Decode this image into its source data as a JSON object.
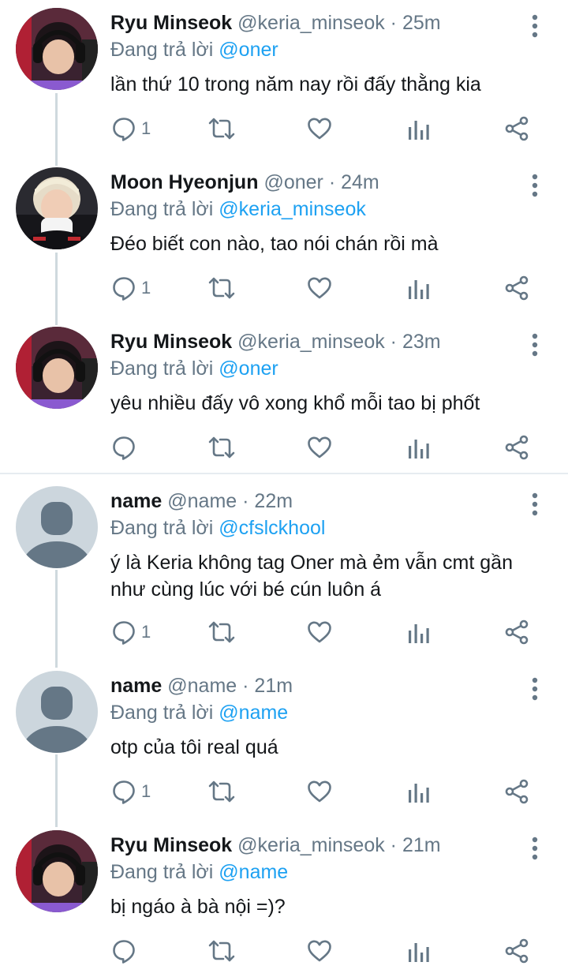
{
  "reply_prefix": "Đang trả lời",
  "dot": "·",
  "colors": {
    "text": "#14171a",
    "secondary": "#657786",
    "accent": "#1da1f2",
    "thread_line": "#cfd9de",
    "divider": "#e6ecf0"
  },
  "tweets": [
    {
      "name": "Ryu Minseok",
      "handle": "@keria_minseok",
      "time": "25m",
      "reply_to": "@oner",
      "text": "lần thứ 10 trong năm nay rồi đấy thằng kia",
      "reply_count": "1",
      "avatar": "keria-photo"
    },
    {
      "name": "Moon Hyeonjun",
      "handle": "@oner",
      "time": "24m",
      "reply_to": "@keria_minseok",
      "text": "Đéo biết con nào, tao nói chán rồi mà",
      "reply_count": "1",
      "avatar": "oner-photo"
    },
    {
      "name": "Ryu Minseok",
      "handle": "@keria_minseok",
      "time": "23m",
      "reply_to": "@oner",
      "text": "yêu nhiều đấy vô xong khổ mỗi tao bị phốt",
      "reply_count": "",
      "avatar": "keria-photo"
    },
    {
      "name": "name",
      "handle": "@name",
      "time": "22m",
      "reply_to": "@cfslckhool",
      "text": "ý là Keria không tag Oner mà ẻm vẫn cmt gần như cùng lúc với bé cún luôn á",
      "reply_count": "1",
      "avatar": "default-avatar"
    },
    {
      "name": "name",
      "handle": "@name",
      "time": "21m",
      "reply_to": "@name",
      "text": "otp của tôi real quá",
      "reply_count": "1",
      "avatar": "default-avatar"
    },
    {
      "name": "Ryu Minseok",
      "handle": "@keria_minseok",
      "time": "21m",
      "reply_to": "@name",
      "text": "bị ngáo à bà nội =)?",
      "reply_count": "",
      "avatar": "keria-photo"
    }
  ],
  "icons": {
    "reply": "reply-icon",
    "retweet": "retweet-icon",
    "like": "heart-icon",
    "analytics": "analytics-icon",
    "share": "share-icon",
    "more": "more-vertical-icon"
  }
}
